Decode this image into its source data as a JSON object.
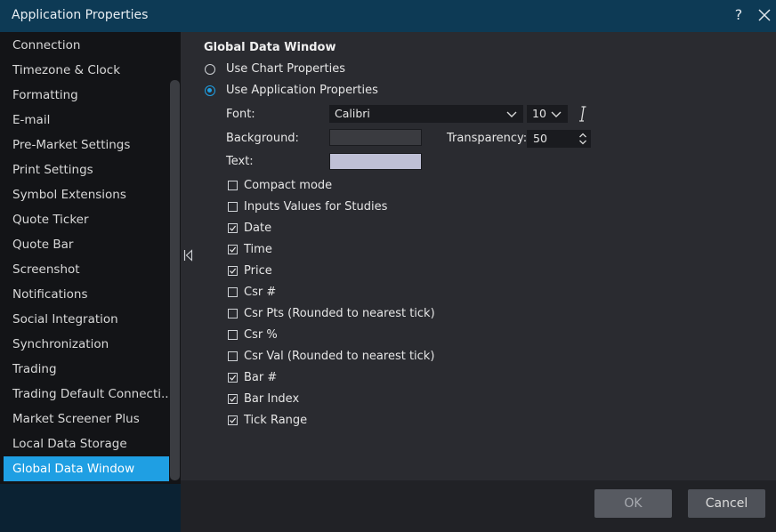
{
  "window": {
    "title": "Application Properties",
    "help_glyph": "?"
  },
  "sidebar": {
    "items": [
      {
        "label": "Connection"
      },
      {
        "label": "Timezone & Clock"
      },
      {
        "label": "Formatting"
      },
      {
        "label": "E-mail"
      },
      {
        "label": "Pre-Market Settings"
      },
      {
        "label": "Print Settings"
      },
      {
        "label": "Symbol Extensions"
      },
      {
        "label": "Quote Ticker"
      },
      {
        "label": "Quote Bar"
      },
      {
        "label": "Screenshot"
      },
      {
        "label": "Notifications"
      },
      {
        "label": "Social Integration"
      },
      {
        "label": "Synchronization"
      },
      {
        "label": "Trading"
      },
      {
        "label": "Trading Default Connecti..."
      },
      {
        "label": "Market Screener Plus"
      },
      {
        "label": "Local Data Storage"
      },
      {
        "label": "Global Data Window"
      }
    ],
    "active_index": 17
  },
  "panel": {
    "heading": "Global Data Window",
    "radios": [
      {
        "label": "Use Chart Properties",
        "checked": false
      },
      {
        "label": "Use Application Properties",
        "checked": true
      }
    ],
    "font_label": "Font:",
    "font_value": "Calibri",
    "font_size": "10",
    "background_label": "Background:",
    "background_color": "#3a3b40",
    "transparency_label": "Transparency:",
    "transparency_value": "50",
    "text_label": "Text:",
    "text_color": "#bfc0d6",
    "checkboxes": [
      {
        "label": "Compact mode",
        "checked": false
      },
      {
        "label": "Inputs Values for Studies",
        "checked": false
      },
      {
        "label": "Date",
        "checked": true
      },
      {
        "label": "Time",
        "checked": true
      },
      {
        "label": "Price",
        "checked": true
      },
      {
        "label": "Csr #",
        "checked": false
      },
      {
        "label": "Csr Pts (Rounded to nearest tick)",
        "checked": false
      },
      {
        "label": "Csr %",
        "checked": false
      },
      {
        "label": "Csr Val (Rounded to nearest tick)",
        "checked": false
      },
      {
        "label": "Bar #",
        "checked": true
      },
      {
        "label": "Bar Index",
        "checked": true
      },
      {
        "label": "Tick Range",
        "checked": true
      }
    ]
  },
  "footer": {
    "ok_label": "OK",
    "cancel_label": "Cancel"
  },
  "icons": {
    "close": "close-icon",
    "help": "help-icon",
    "collapse": "collapse-left-icon",
    "dropdown": "chevron-down-icon",
    "spinner": "spinner-arrows-icon",
    "text_cursor": "text-cursor-icon",
    "check": "checkmark-icon"
  },
  "colors": {
    "accent": "#1f9fe3",
    "titlebar": "#0d3a55",
    "panel": "#2a2b30",
    "sidebar": "#131417"
  }
}
